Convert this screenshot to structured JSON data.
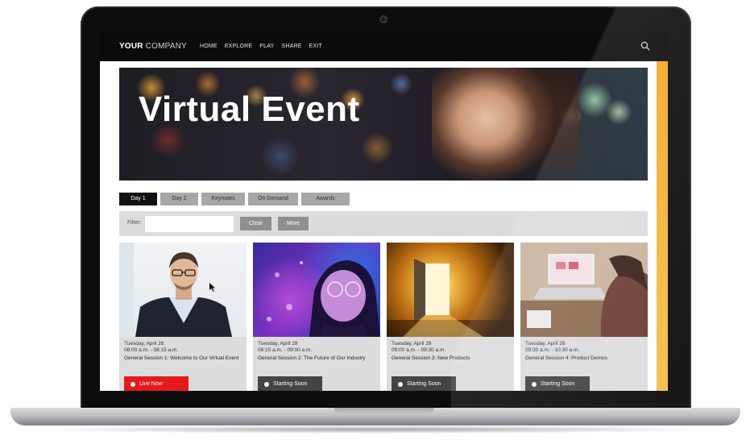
{
  "header": {
    "brand_bold": "YOUR",
    "brand_light": " COMPANY",
    "nav": [
      "HOME",
      "EXPLORE",
      "PLAY",
      "SHARE",
      "EXIT"
    ]
  },
  "hero": {
    "title": "Virtual Event"
  },
  "tabs": [
    {
      "label": "Day 1",
      "active": true
    },
    {
      "label": "Day 2",
      "active": false
    },
    {
      "label": "Keynotes",
      "active": false
    },
    {
      "label": "On Demand",
      "active": false
    },
    {
      "label": "Awards",
      "active": false
    }
  ],
  "filter": {
    "label": "Filter:",
    "value": "",
    "clear_label": "Clear",
    "more_label": "More"
  },
  "sessions": [
    {
      "date": "Tuesday, April 28",
      "time": "08:00 a.m. - 08:15 a.m.",
      "title": "General Session 1: Welcome to Our Virtual Event",
      "button": "Live Now",
      "status": "live"
    },
    {
      "date": "Tuesday, April 28",
      "time": "08:15 a.m. - 09:00 a.m.",
      "title": "General Session 2: The Future of Our Industry",
      "button": "Starting Soon",
      "status": "soon"
    },
    {
      "date": "Tuesday, April 28",
      "time": "09:00 a.m. - 09:30 a.m.",
      "title": "General Session 3: New Products",
      "button": "Starting Soon",
      "status": "soon"
    },
    {
      "date": "Tuesday, April 28",
      "time": "09:30 a.m. - 10:30 a.m.",
      "title": "General Session 4: Product Demos",
      "button": "Starting Soon",
      "status": "soon"
    }
  ],
  "colors": {
    "accent": "#f6a823",
    "live": "#e31b1b",
    "topbar": "#0b0b0b"
  }
}
